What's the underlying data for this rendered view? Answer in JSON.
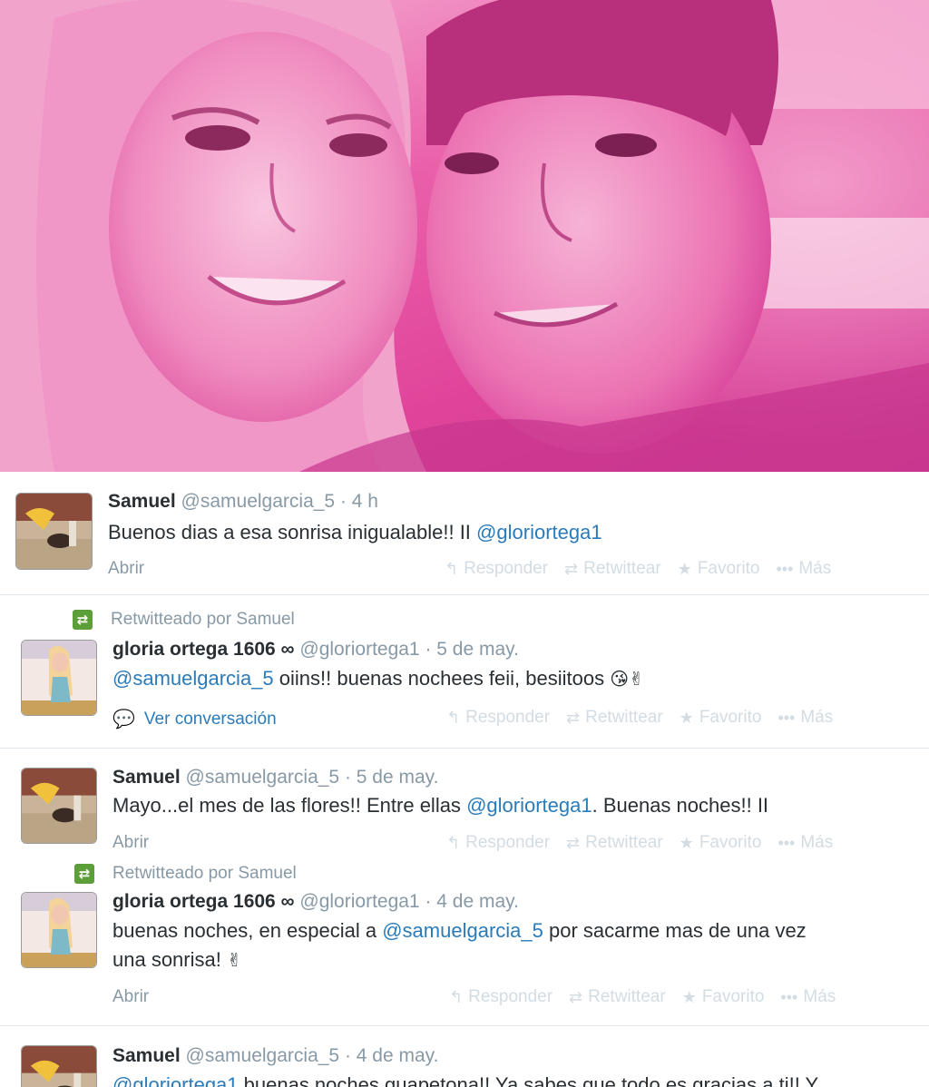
{
  "photo": {
    "alt": ""
  },
  "tweets": [
    {
      "name": "Samuel",
      "handle": "@samuelgarcia_5",
      "time": "· 4 h",
      "text_before": "Buenos dias a esa sonrisa inigualable!!   II ",
      "mention": "@gloriortega1",
      "text_after": "",
      "link": "Abrir"
    },
    {
      "retweet_context": "Retwitteado por Samuel",
      "name": "gloria ortega 1606 ∞",
      "handle": "@gloriortega1",
      "time": "· 5 de may.",
      "mention": "@samuelgarcia_5",
      "text_after": " oiins!! buenas nochees feii, besiitoos",
      "emoji": "😘✌",
      "link": "Ver conversación"
    },
    {
      "name": "Samuel",
      "handle": "@samuelgarcia_5",
      "time": "· 5 de may.",
      "text_before": "Mayo...el mes de las flores!! Entre ellas ",
      "mention": "@gloriortega1",
      "text_after": ". Buenas noches!!   II",
      "link": "Abrir"
    },
    {
      "retweet_context": "Retwitteado por Samuel",
      "name": "gloria ortega 1606 ∞",
      "handle": "@gloriortega1",
      "time": "· 4 de may.",
      "text_before": "buenas noches, en especial a ",
      "mention": "@samuelgarcia_5",
      "text_after": " por sacarme mas de una vez",
      "line2": "una sonrisa! ",
      "emoji": "✌",
      "link": "Abrir"
    },
    {
      "name": "Samuel",
      "handle": "@samuelgarcia_5",
      "time": "· 4 de may.",
      "mention": "@gloriortega1",
      "text_after": " buenas noches guapetona!! Ya sabes que todo es gracias a ti!! Y"
    }
  ],
  "actions": {
    "reply": "Responder",
    "retweet": "Retwittear",
    "favorite": "Favorito",
    "more": "Más"
  },
  "colors": {
    "link": "#2b7bb9",
    "muted": "#8899a6",
    "retweet_green": "#5c9e3a",
    "photo_pink": "#e0449a"
  }
}
